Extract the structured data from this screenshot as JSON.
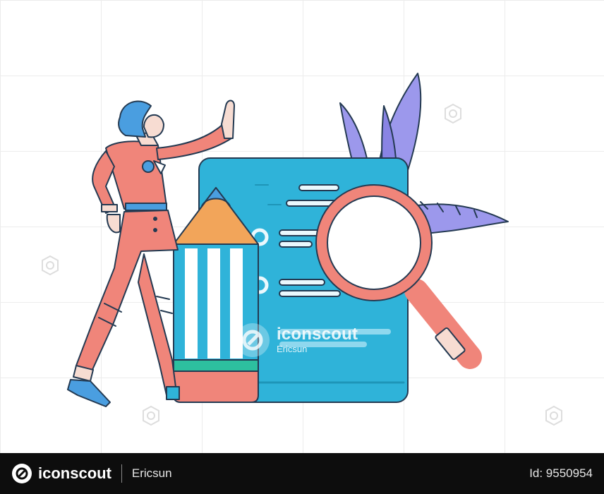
{
  "watermark": {
    "brand": "iconscout",
    "author": "Ericsun"
  },
  "footer": {
    "brand": "iconscout",
    "author": "Ericsun",
    "asset_id": "Id: 9550954"
  },
  "colors": {
    "coral": "#f0857a",
    "blue": "#2fb3d9",
    "lavender": "#9c98ec",
    "orange": "#f2a55a",
    "green": "#2dbf9f",
    "outline": "#243a52",
    "grid": "#ececec",
    "bar": "#0d0d0d"
  }
}
